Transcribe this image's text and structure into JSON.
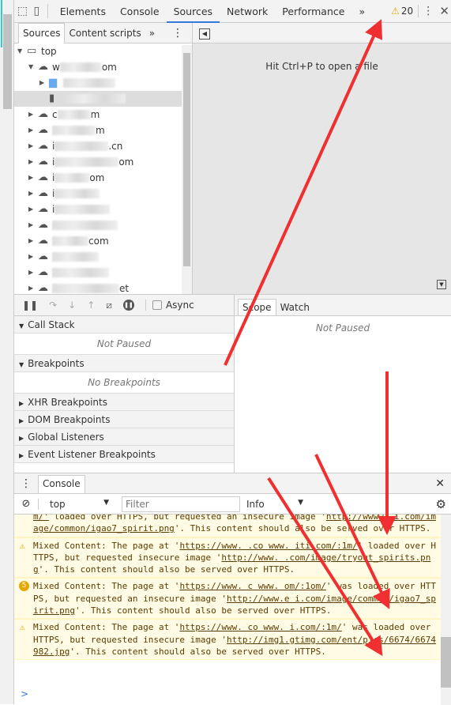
{
  "toolbar": {
    "tabs": [
      "Elements",
      "Console",
      "Sources",
      "Network",
      "Performance"
    ],
    "active_tab": "Sources",
    "more": "»",
    "warning_count": "20",
    "icons": [
      "inspect-icon",
      "device-icon",
      "more-tabs-icon",
      "warning-icon",
      "kebab-menu-icon",
      "close-icon"
    ]
  },
  "navigator": {
    "tabs": [
      "Sources",
      "Content scripts"
    ],
    "more": "»",
    "tree": [
      {
        "label": "top",
        "type": "frame",
        "depth": 0
      },
      {
        "label": "w",
        "suffix": "om",
        "type": "cloud",
        "depth": 1,
        "expanded": true
      },
      {
        "label": "",
        "type": "folder",
        "depth": 2
      },
      {
        "label": "",
        "type": "file",
        "depth": 2,
        "selected": true
      },
      {
        "label": "c",
        "suffix": "m",
        "type": "cloud",
        "depth": 1
      },
      {
        "label": "",
        "suffix": "m",
        "type": "cloud",
        "depth": 1
      },
      {
        "label": "i",
        "suffix": ".cn",
        "type": "cloud",
        "depth": 1
      },
      {
        "label": "i",
        "suffix": "om",
        "type": "cloud",
        "depth": 1
      },
      {
        "label": "i",
        "suffix": "om",
        "type": "cloud",
        "depth": 1
      },
      {
        "label": "i",
        "suffix": "",
        "type": "cloud",
        "depth": 1
      },
      {
        "label": "i",
        "suffix": "",
        "type": "cloud",
        "depth": 1
      },
      {
        "label": "",
        "suffix": "",
        "type": "cloud",
        "depth": 1
      },
      {
        "label": "",
        "suffix": "com",
        "type": "cloud",
        "depth": 1
      },
      {
        "label": "",
        "suffix": "",
        "type": "cloud",
        "depth": 1
      },
      {
        "label": "",
        "suffix": "",
        "type": "cloud",
        "depth": 1
      },
      {
        "label": "",
        "suffix": "et",
        "type": "cloud",
        "depth": 1
      },
      {
        "label": "",
        "suffix": "et",
        "type": "cloud",
        "depth": 1
      }
    ]
  },
  "editor": {
    "hint": "Hit Ctrl+P to open a file"
  },
  "debugger": {
    "async_label": "Async",
    "async_checked": false,
    "sections": [
      {
        "title": "Call Stack",
        "expanded": true,
        "empty": "Not Paused"
      },
      {
        "title": "Breakpoints",
        "expanded": true,
        "empty": "No Breakpoints"
      },
      {
        "title": "XHR Breakpoints",
        "expanded": false
      },
      {
        "title": "DOM Breakpoints",
        "expanded": false
      },
      {
        "title": "Global Listeners",
        "expanded": false
      },
      {
        "title": "Event Listener Breakpoints",
        "expanded": false
      }
    ]
  },
  "scope": {
    "tabs": [
      "Scope",
      "Watch"
    ],
    "active": "Scope",
    "empty": "Not Paused"
  },
  "console": {
    "tab": "Console",
    "context": "top",
    "filter_placeholder": "Filter",
    "level": "Info",
    "prompt": ">",
    "messages": [
      {
        "icon": "none",
        "parts": [
          [
            "u",
            "m/'"
          ],
          [
            "t",
            "   loaded over HTTPS, but requested an insecure image '"
          ],
          [
            "u",
            "http://ww"
          ],
          [
            "u",
            "ww.      i.com/image/common/igao7_spirit.png"
          ],
          [
            "t",
            "'. This content should also be served over HTTPS."
          ]
        ]
      },
      {
        "icon": "warning",
        "parts": [
          [
            "t",
            "Mixed Content: The page at '"
          ],
          [
            "u",
            "https://www.       .co  www.     iti.com/:1m/"
          ],
          [
            "t",
            "'     loaded over HTTPS, but requested      insecure image '"
          ],
          [
            "u",
            "http://www.       .com/image/tryout_spirits.png"
          ],
          [
            "t",
            "'. This content should also be served over HTTPS."
          ]
        ]
      },
      {
        "icon": "count",
        "count": "5",
        "parts": [
          [
            "t",
            "Mixed Content: The page at '"
          ],
          [
            "u",
            "https://www.       c   www.        om/:1om/"
          ],
          [
            "t",
            "' was loaded over HTTPS, but requested an insecure image '"
          ],
          [
            "u",
            "http://www.e     i.com/image/common/igao7_spirit.png"
          ],
          [
            "t",
            "'. This content should also be served over HTTPS."
          ]
        ]
      },
      {
        "icon": "warning",
        "parts": [
          [
            "t",
            "Mixed Content: The page at '"
          ],
          [
            "u",
            "https://www.       co  www.     i.com/:1m/"
          ],
          [
            "t",
            "' was loaded over HTTPS, but requested   insecure image '"
          ],
          [
            "u",
            "http://img1.gtimg.com/ent/pics/6674/6674982.jpg"
          ],
          [
            "t",
            "'. This content should also be served over HTTPS."
          ]
        ]
      }
    ]
  },
  "colors": {
    "accent": "#3879d9",
    "warning": "#e6a800",
    "warning_bg": "#fffbe5",
    "annotation": "#f03030"
  }
}
